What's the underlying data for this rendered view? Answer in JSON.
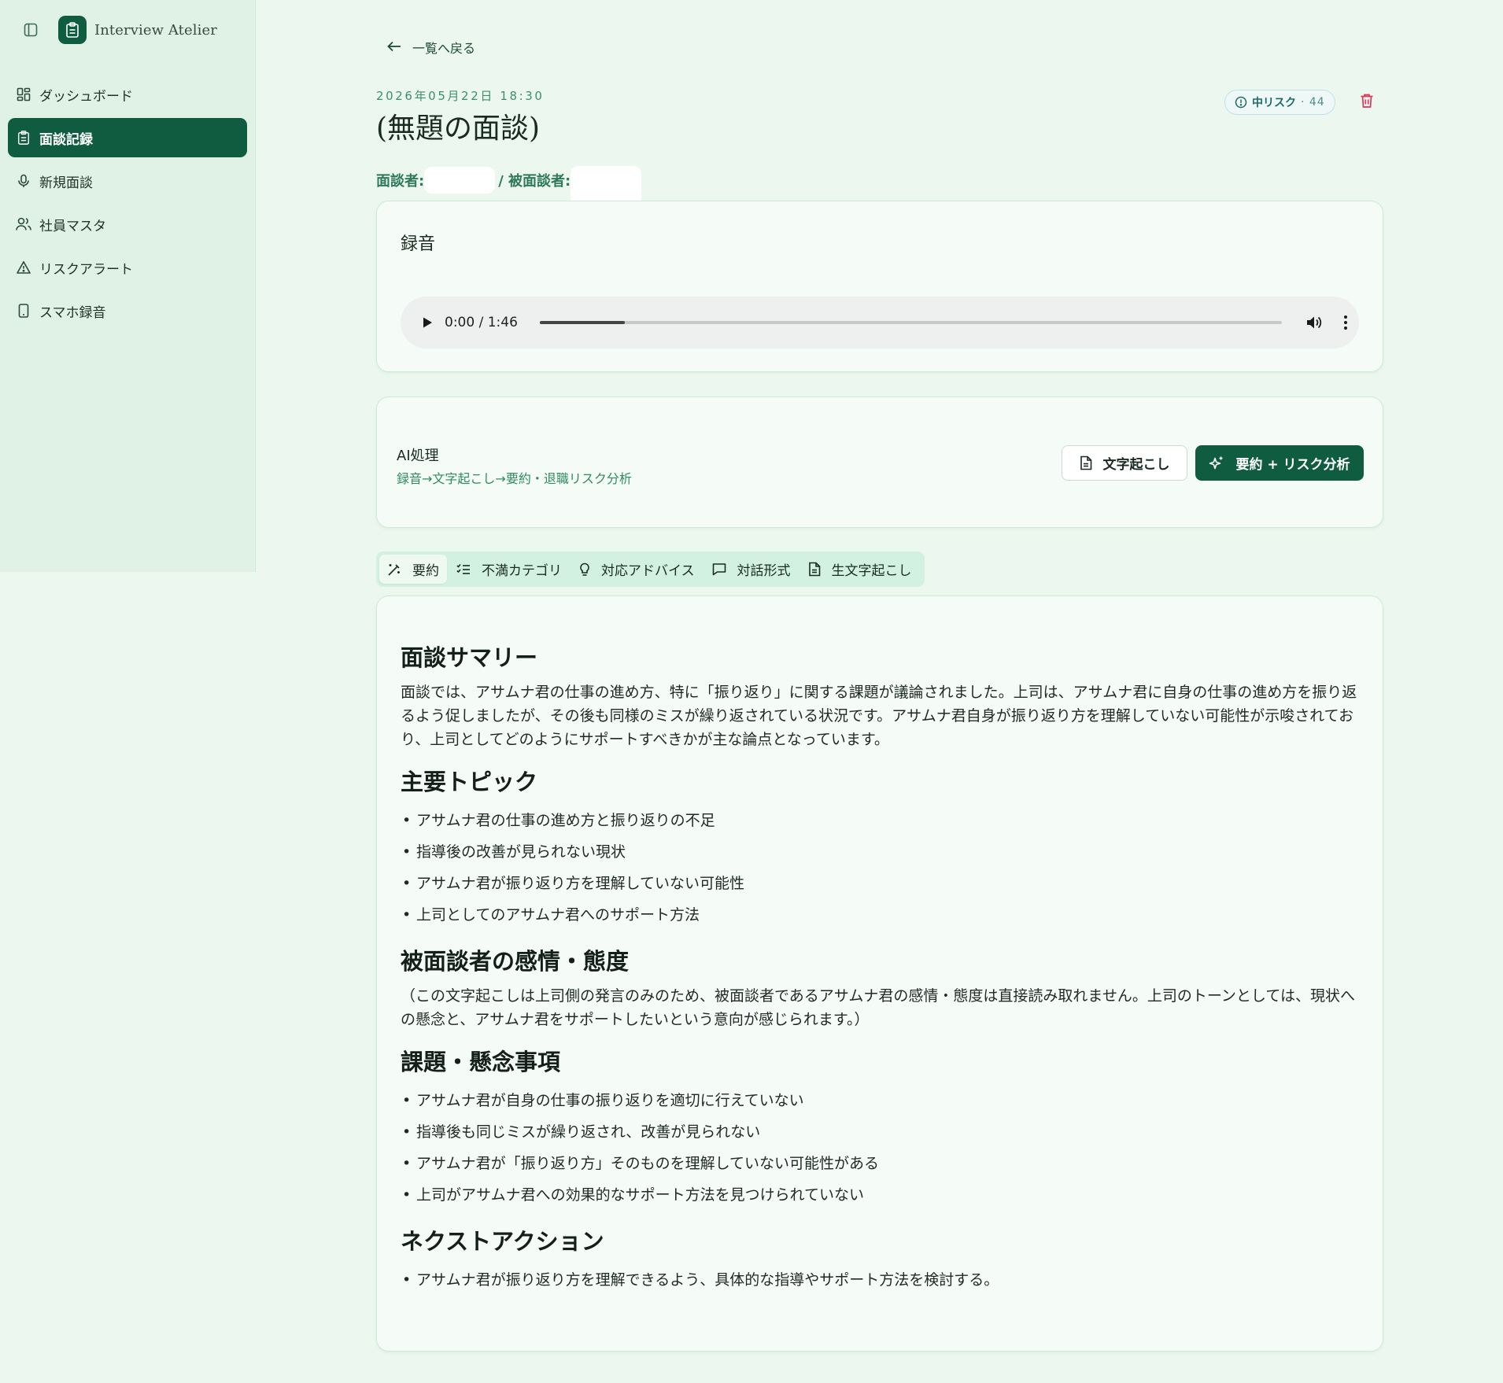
{
  "app": {
    "title": "Interview Atelier"
  },
  "sidebar": {
    "items": [
      {
        "label": "ダッシュボード",
        "icon": "dashboard-icon"
      },
      {
        "label": "面談記録",
        "icon": "clipboard-icon",
        "active": true
      },
      {
        "label": "新規面談",
        "icon": "microphone-icon"
      },
      {
        "label": "社員マスタ",
        "icon": "users-icon"
      },
      {
        "label": "リスクアラート",
        "icon": "alert-triangle-icon"
      },
      {
        "label": "スマホ録音",
        "icon": "smartphone-icon"
      }
    ]
  },
  "header": {
    "back_label": "一覧へ戻る",
    "datetime": "2026年05月22日 18:30",
    "title": "(無題の面談)",
    "interviewer_label": "面談者:",
    "interviewee_label": "/ 被面談者:",
    "risk_label": "中リスク",
    "risk_score": "· 44"
  },
  "recording": {
    "title": "録音",
    "time": "0:00 / 1:46",
    "progress_fraction": 0.115
  },
  "ai": {
    "title": "AI処理",
    "subtitle": "録音→文字起こし→要約・退職リスク分析",
    "transcribe_label": "文字起こし",
    "analyze_label": "要約 + リスク分析"
  },
  "tabs": [
    {
      "label": "要約",
      "icon": "wand-icon",
      "active": true
    },
    {
      "label": "不満カテゴリ",
      "icon": "checklist-icon"
    },
    {
      "label": "対応アドバイス",
      "icon": "lightbulb-icon"
    },
    {
      "label": "対話形式",
      "icon": "chat-icon"
    },
    {
      "label": "生文字起こし",
      "icon": "document-icon"
    }
  ],
  "summary": {
    "s1_title": "面談サマリー",
    "s1_body": "面談では、アサムナ君の仕事の進め方、特に「振り返り」に関する課題が議論されました。上司は、アサムナ君に自身の仕事の進め方を振り返るよう促しましたが、その後も同様のミスが繰り返されている状況です。アサムナ君自身が振り返り方を理解していない可能性が示唆されており、上司としてどのようにサポートすべきかが主な論点となっています。",
    "s2_title": "主要トピック",
    "s2_items": [
      "アサムナ君の仕事の進め方と振り返りの不足",
      "指導後の改善が見られない現状",
      "アサムナ君が振り返り方を理解していない可能性",
      "上司としてのアサムナ君へのサポート方法"
    ],
    "s3_title": "被面談者の感情・態度",
    "s3_body": "（この文字起こしは上司側の発言のみのため、被面談者であるアサムナ君の感情・態度は直接読み取れません。上司のトーンとしては、現状への懸念と、アサムナ君をサポートしたいという意向が感じられます。）",
    "s4_title": "課題・懸念事項",
    "s4_items": [
      "アサムナ君が自身の仕事の振り返りを適切に行えていない",
      "指導後も同じミスが繰り返され、改善が見られない",
      "アサムナ君が「振り返り方」そのものを理解していない可能性がある",
      "上司がアサムナ君への効果的なサポート方法を見つけられていない"
    ],
    "s5_title": "ネクストアクション",
    "s5_items": [
      "アサムナ君が振り返り方を理解できるよう、具体的な指導やサポート方法を検討する。"
    ]
  },
  "colors": {
    "brand": "#0f5c40",
    "background": "#ecf8ef",
    "sidebar": "#e0f1e5",
    "accent_text": "#2e7a58",
    "danger": "#e0345a"
  }
}
